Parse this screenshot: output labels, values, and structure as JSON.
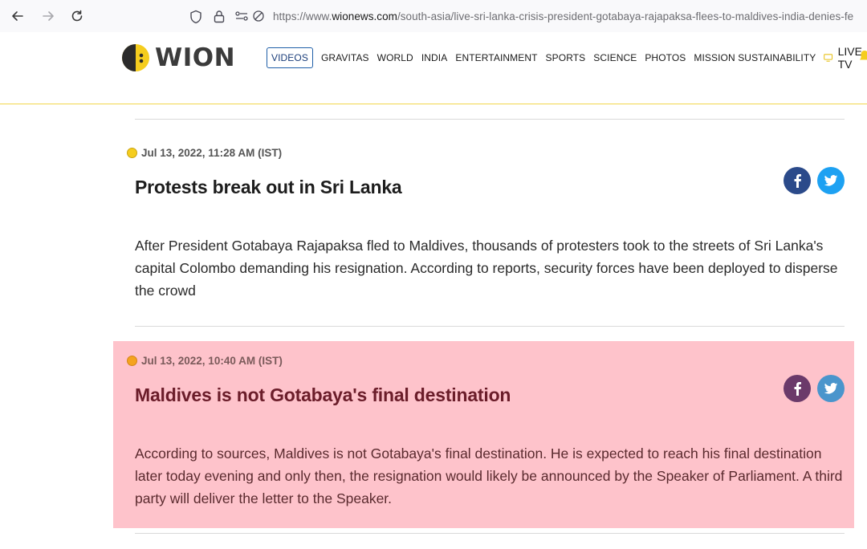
{
  "browser": {
    "url_prefix": "https://www.",
    "url_host": "wionews.com",
    "url_path": "/south-asia/live-sri-lanka-crisis-president-gotabaya-rajapaksa-flees-to-maldives-india-denies-fe"
  },
  "site": {
    "logo_text": "WION",
    "nav": [
      "VIDEOS",
      "GRAVITAS",
      "WORLD",
      "INDIA",
      "ENTERTAINMENT",
      "SPORTS",
      "SCIENCE",
      "PHOTOS",
      "MISSION SUSTAINABILITY"
    ],
    "live_tv": "LIVE TV"
  },
  "entries": [
    {
      "timestamp": "Jul 13, 2022, 11:28 AM (IST)",
      "headline": "Protests break out in Sri Lanka",
      "body": "After President Gotabaya Rajapaksa fled to Maldives, thousands of protesters took to the streets of Sri Lanka's capital Colombo demanding his resignation. According to reports, security forces have been deployed to disperse the crowd",
      "dot_color": "#f5cd1e"
    },
    {
      "timestamp": "Jul 13, 2022, 10:40 AM (IST)",
      "headline": "Maldives is not Gotabaya's final destination",
      "body": "According to sources, Maldives is not Gotabaya's final destination. He is expected to reach his final destination later today evening and only then, the resignation would likely be announced by the Speaker of Parliament. A third party will deliver the letter to the Speaker.",
      "dot_color": "#f5a31e",
      "highlight_color": "#fec3cb"
    }
  ],
  "colors": {
    "facebook": "#2b4a8a",
    "twitter": "#1da1f2",
    "accent": "#f2d64b"
  }
}
